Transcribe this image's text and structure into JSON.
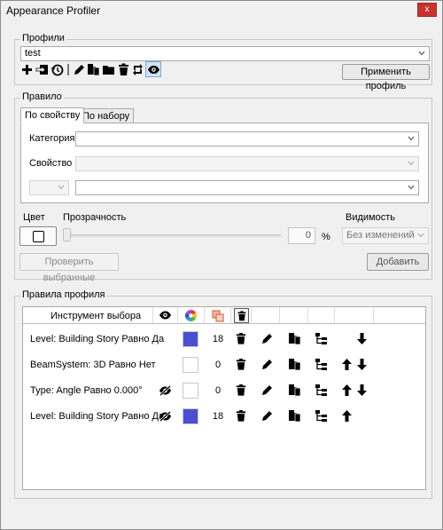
{
  "window": {
    "title": "Appearance Profiler",
    "close_glyph": "x"
  },
  "profiles": {
    "legend": "Профили",
    "selected": "test",
    "apply_label": "Применить профиль",
    "toolbar_icons": [
      "add-icon",
      "import-icon",
      "history-icon",
      "separator",
      "edit-icon",
      "copy-icon",
      "folder-icon",
      "delete-icon",
      "refresh-icon",
      "eye-icon"
    ]
  },
  "rule": {
    "legend": "Правило",
    "tabs": [
      "По свойству",
      "По набору"
    ],
    "category_label": "Категория",
    "property_label": "Свойство",
    "category_value": "",
    "property_value": "",
    "condition_value": "",
    "value_field": "",
    "color_label": "Цвет",
    "transparency_label": "Прозрачность",
    "transparency_value": "0",
    "percent_label": "%",
    "visibility_label": "Видимость",
    "visibility_value": "Без изменений",
    "check_selected_label": "Проверить выбранные",
    "add_label": "Добавить",
    "transparency_level": 0
  },
  "profile_rules": {
    "legend": "Правила профиля",
    "header": {
      "selector_label": "Инструмент выбора"
    },
    "rows": [
      {
        "selector": "Level: Building Story Равно Да",
        "hidden": false,
        "color": "#4a4fd1",
        "transparency": "18",
        "up": false,
        "down": true
      },
      {
        "selector": "BeamSystem: 3D Равно Нет",
        "hidden": false,
        "color": "#ffffff",
        "transparency": "0",
        "up": true,
        "down": true
      },
      {
        "selector": "Type: Angle Равно 0.000°",
        "hidden": true,
        "color": "#ffffff",
        "transparency": "0",
        "up": true,
        "down": true
      },
      {
        "selector": "Level: Building Story Равно Да",
        "hidden": true,
        "color": "#4a4fd1",
        "transparency": "18",
        "up": true,
        "down": false
      }
    ]
  }
}
